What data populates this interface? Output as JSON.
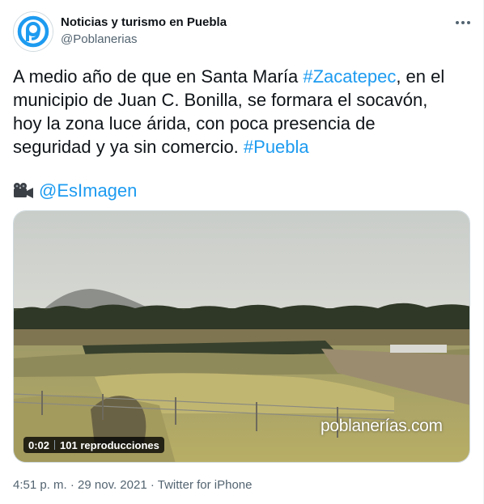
{
  "author": {
    "name": "Noticias y turismo en Puebla",
    "handle": "@Poblanerias",
    "avatar_color": "#1d9bf0"
  },
  "menu": {
    "icon": "more-horizontal-icon"
  },
  "tweet": {
    "segments": [
      [
        {
          "text": "A medio año de que en Santa María ",
          "link": false
        },
        {
          "text": "#Zacatepec",
          "link": true
        },
        {
          "text": ", en el",
          "link": false
        }
      ],
      [
        {
          "text": "municipio de Juan C. Bonilla, se formara el socavón,",
          "link": false
        }
      ],
      [
        {
          "text": "hoy la zona luce árida, con poca presencia de",
          "link": false
        }
      ],
      [
        {
          "text": "seguridad y ya sin comercio. ",
          "link": false
        },
        {
          "text": "#Puebla",
          "link": true
        }
      ]
    ],
    "credit_icon": "movie-camera-icon",
    "credit_mention": "@EsImagen"
  },
  "video": {
    "watermark": "poblanerías.com",
    "time": "0:02",
    "views": "101 reproducciones"
  },
  "meta": {
    "time": "4:51 p. m.",
    "date": "29 nov. 2021",
    "source": "Twitter for iPhone",
    "separator": "·"
  },
  "colors": {
    "link": "#1d9bf0",
    "text": "#0f1419",
    "secondary": "#536471"
  }
}
